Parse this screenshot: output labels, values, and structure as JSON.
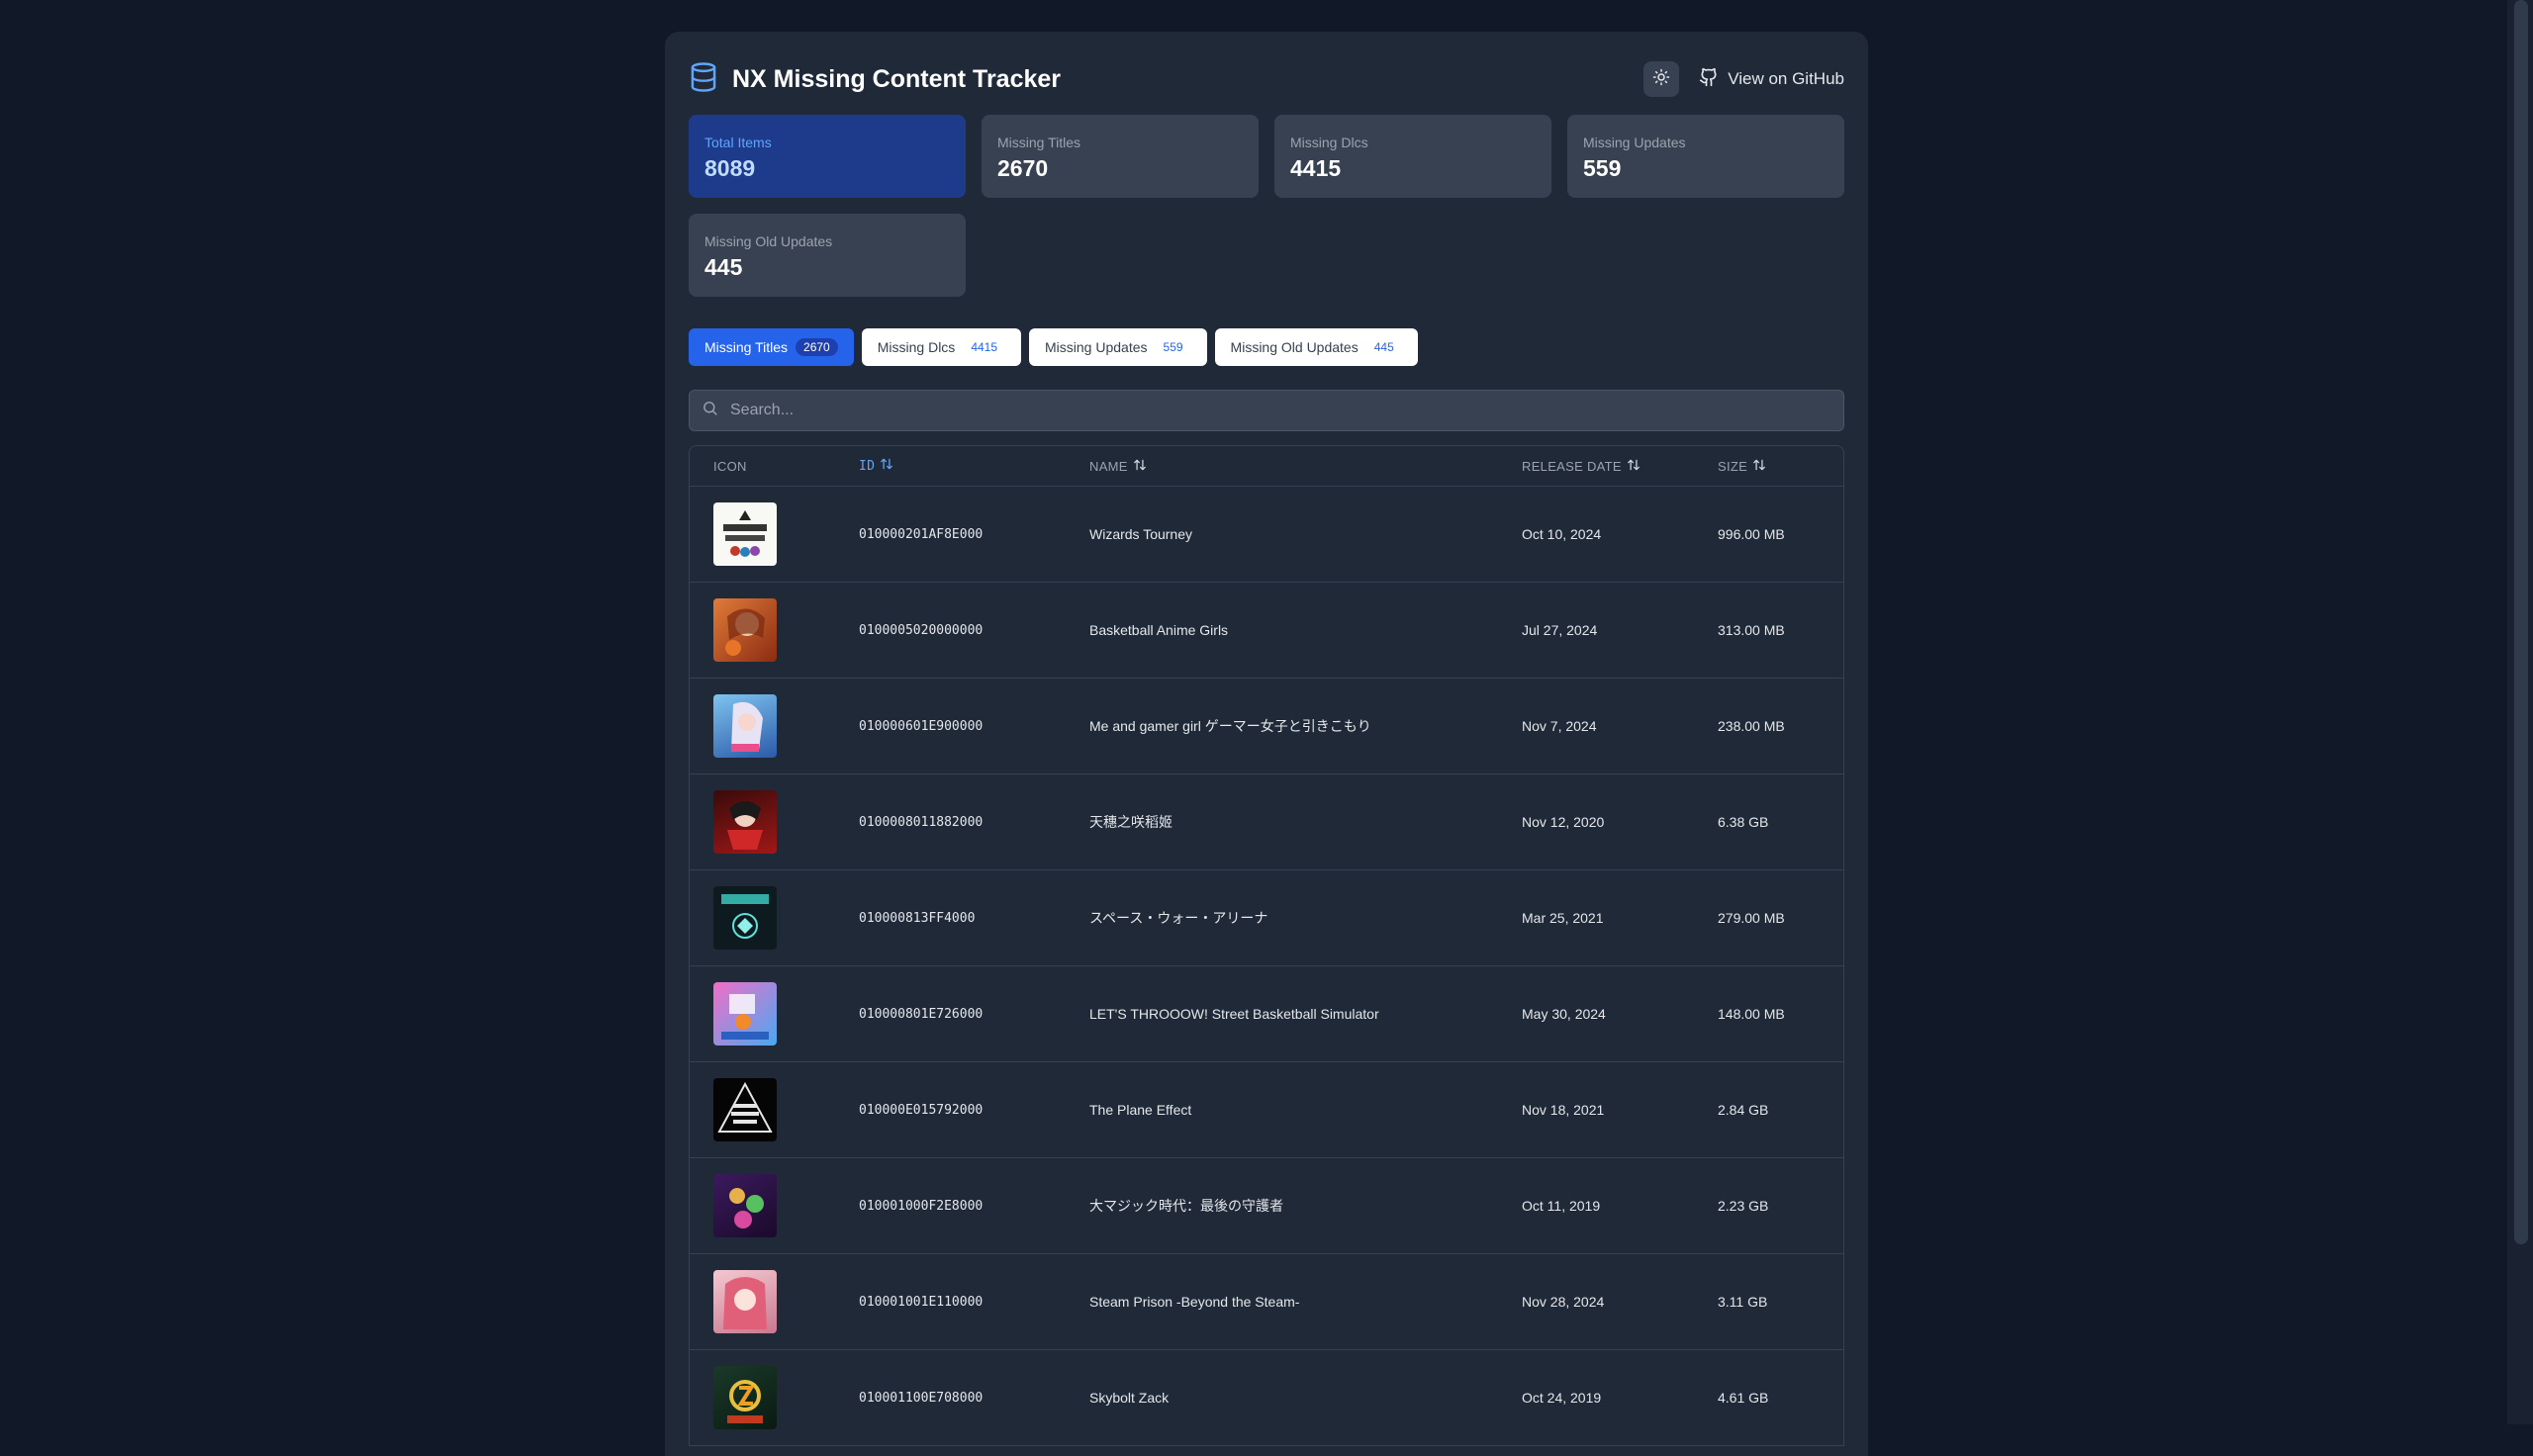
{
  "app": {
    "title": "NX Missing Content Tracker",
    "github_label": "View on GitHub"
  },
  "stats": [
    {
      "label": "Total Items",
      "value": "8089"
    },
    {
      "label": "Missing Titles",
      "value": "2670"
    },
    {
      "label": "Missing Dlcs",
      "value": "4415"
    },
    {
      "label": "Missing Updates",
      "value": "559"
    },
    {
      "label": "Missing Old Updates",
      "value": "445"
    }
  ],
  "tabs": [
    {
      "label": "Missing Titles",
      "count": "2670"
    },
    {
      "label": "Missing Dlcs",
      "count": "4415"
    },
    {
      "label": "Missing Updates",
      "count": "559"
    },
    {
      "label": "Missing Old Updates",
      "count": "445"
    }
  ],
  "search": {
    "placeholder": "Search..."
  },
  "table": {
    "columns": {
      "icon": "Icon",
      "id": "ID",
      "name": "Name",
      "release_date": "Release Date",
      "size": "Size"
    },
    "rows": [
      {
        "id": "010000201AF8E000",
        "name": "Wizards Tourney",
        "release_date": "Oct 10, 2024",
        "size": "996.00 MB"
      },
      {
        "id": "0100005020000000",
        "name": "Basketball Anime Girls",
        "release_date": "Jul 27, 2024",
        "size": "313.00 MB"
      },
      {
        "id": "010000601E900000",
        "name": "Me and gamer girl ゲーマー女子と引きこもり",
        "release_date": "Nov 7, 2024",
        "size": "238.00 MB"
      },
      {
        "id": "0100008011882000",
        "name": "天穗之咲稻姬",
        "release_date": "Nov 12, 2020",
        "size": "6.38 GB"
      },
      {
        "id": "010000813FF4000",
        "name": "スペース・ウォー・アリーナ",
        "release_date": "Mar 25, 2021",
        "size": "279.00 MB"
      },
      {
        "id": "010000801E726000",
        "name": "LET'S THROOOW! Street Basketball Simulator",
        "release_date": "May 30, 2024",
        "size": "148.00 MB"
      },
      {
        "id": "010000E015792000",
        "name": "The Plane Effect",
        "release_date": "Nov 18, 2021",
        "size": "2.84 GB"
      },
      {
        "id": "010001000F2E8000",
        "name": "大マジック時代：最後の守護者",
        "release_date": "Oct 11, 2019",
        "size": "2.23 GB"
      },
      {
        "id": "010001001E110000",
        "name": "Steam Prison -Beyond the Steam-",
        "release_date": "Nov 28, 2024",
        "size": "3.11 GB"
      },
      {
        "id": "010001100E708000",
        "name": "Skybolt Zack",
        "release_date": "Oct 24, 2019",
        "size": "4.61 GB"
      }
    ]
  },
  "icons": {
    "brand": "database-icon",
    "theme": "sun-icon",
    "github": "github-icon",
    "search": "search-icon",
    "sort": "sort-arrows-icon"
  },
  "colors": {
    "accent": "#2563eb",
    "background": "#111827",
    "panel": "#1f2937",
    "card": "#374151",
    "active_card": "#1e3a8a"
  }
}
